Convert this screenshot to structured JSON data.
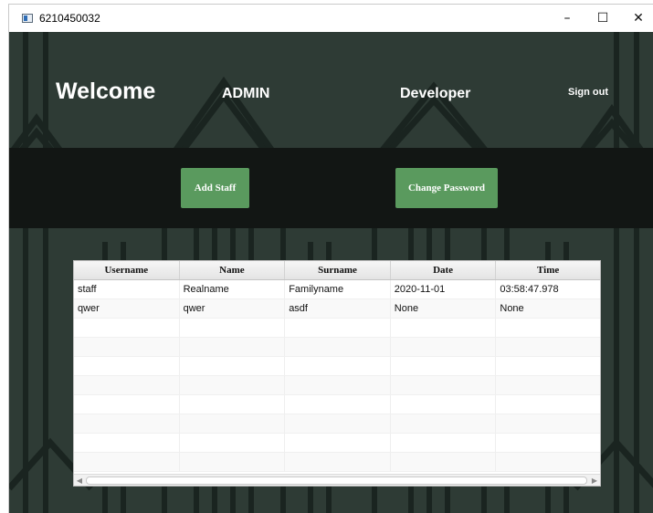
{
  "window": {
    "title": "6210450032"
  },
  "header": {
    "welcome": "Welcome",
    "role": "ADMIN",
    "department": "Developer",
    "sign_out": "Sign out"
  },
  "actions": {
    "add_staff": "Add Staff",
    "change_password": "Change Password"
  },
  "table": {
    "columns": [
      "Username",
      "Name",
      "Surname",
      "Date",
      "Time"
    ],
    "rows": [
      [
        "staff",
        "Realname",
        "Familyname",
        "2020-11-01",
        "03:58:47.978"
      ],
      [
        "qwer",
        "qwer",
        "asdf",
        "None",
        "None"
      ]
    ]
  },
  "colors": {
    "background": "#2e3b35",
    "band": "#121614",
    "button": "#5a9a5e"
  }
}
